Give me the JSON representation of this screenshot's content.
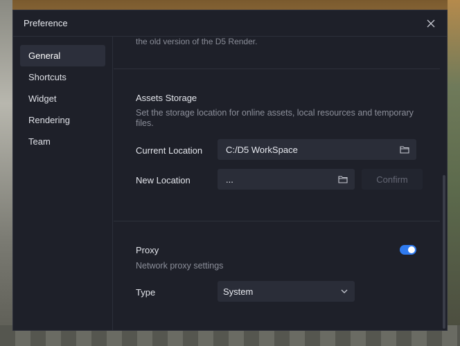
{
  "dialog": {
    "title": "Preference",
    "close_icon": "close-icon"
  },
  "sidebar": {
    "items": [
      {
        "label": "General",
        "active": true
      },
      {
        "label": "Shortcuts",
        "active": false
      },
      {
        "label": "Widget",
        "active": false
      },
      {
        "label": "Rendering",
        "active": false
      },
      {
        "label": "Team",
        "active": false
      }
    ]
  },
  "main": {
    "prev_desc_tail": "the old version of the D5 Render.",
    "assets": {
      "title": "Assets Storage",
      "description": "Set the storage location for online assets, local resources and temporary files.",
      "current_label": "Current Location",
      "current_value": "C:/D5 WorkSpace",
      "new_label": "New Location",
      "new_value": "...",
      "confirm_label": "Confirm",
      "folder_icon": "folder-icon"
    },
    "proxy": {
      "title": "Proxy",
      "enabled": true,
      "description": "Network proxy settings",
      "type_label": "Type",
      "type_value": "System",
      "chevron_icon": "chevron-down-icon"
    }
  },
  "colors": {
    "dialog_bg": "#1e2029",
    "field_bg": "#2a2d38",
    "accent": "#2f7bf0",
    "muted_text": "#8c8f9a"
  }
}
